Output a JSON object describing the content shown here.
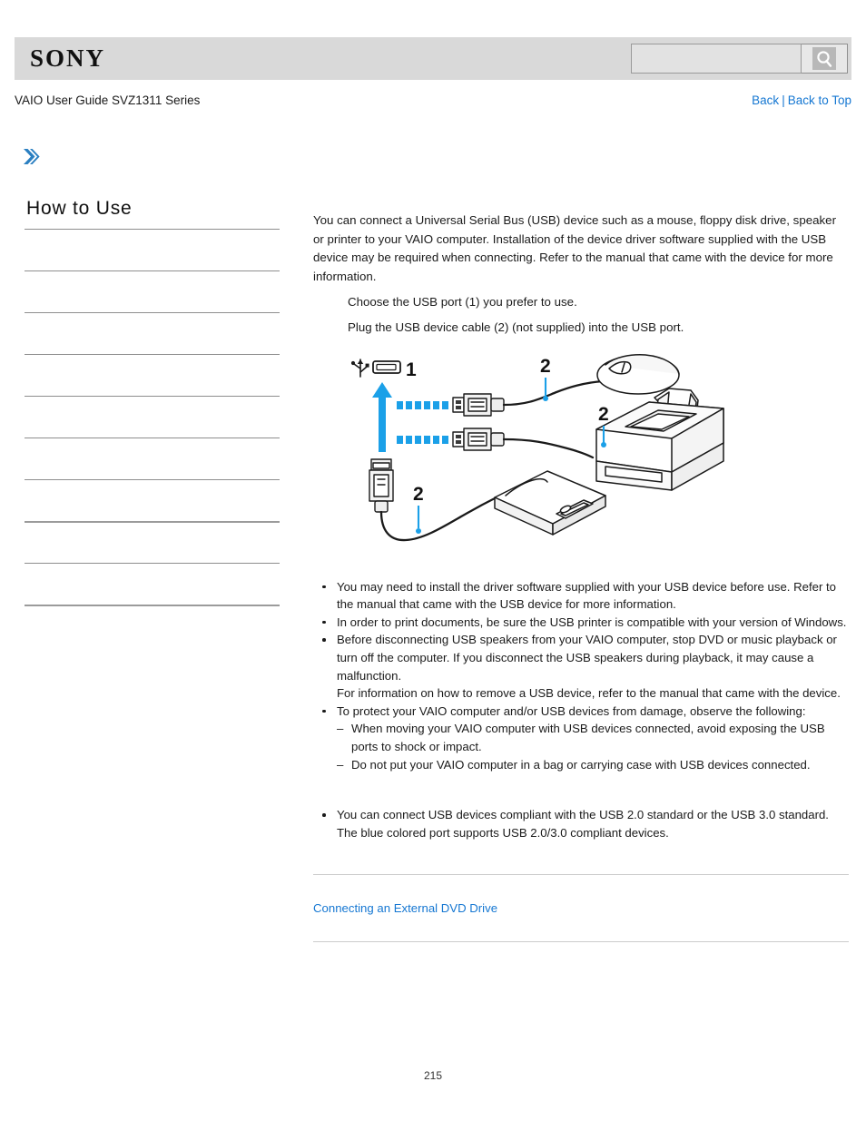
{
  "header": {
    "logo_text": "SONY",
    "search": {
      "value": "",
      "placeholder": "",
      "icon": "search-icon"
    }
  },
  "subheader": {
    "guide_title": "VAIO User Guide SVZ1311 Series",
    "links": {
      "back": "Back",
      "separator": "|",
      "back_to_top": "Back to Top"
    }
  },
  "breadcrumb_icon": "double-chevron-right-icon",
  "sidebar": {
    "title": "How to Use",
    "items": [
      {
        "label": ""
      },
      {
        "label": ""
      },
      {
        "label": ""
      },
      {
        "label": ""
      },
      {
        "label": ""
      },
      {
        "label": ""
      },
      {
        "label": ""
      },
      {
        "label": ""
      },
      {
        "label": ""
      },
      {
        "label": ""
      }
    ]
  },
  "main": {
    "intro": "You can connect a Universal Serial Bus (USB) device such as a mouse, floppy disk drive, speaker or printer to your VAIO computer. Installation of the device driver software supplied with the USB device may be required when connecting. Refer to the manual that came with the device for more information.",
    "steps": [
      "Choose the USB port (1) you prefer to use.",
      "Plug the USB device cable (2) (not supplied) into the USB port."
    ],
    "illustration": {
      "name": "usb-connection-diagram",
      "callout_port": "1",
      "callout_cable_mouse": "2",
      "callout_cable_printer": "2",
      "callout_cable_drive": "2",
      "devices": [
        "mouse",
        "printer",
        "floppy-disk-drive"
      ],
      "accent_color": "#1ba0e8"
    },
    "notes": [
      {
        "text": "You may need to install the driver software supplied with your USB device before use. Refer to the manual that came with the USB device for more information."
      },
      {
        "text": "In order to print documents, be sure the USB printer is compatible with your version of Windows."
      },
      {
        "text": "Before disconnecting USB speakers from your VAIO computer, stop DVD or music playback or turn off the computer. If you disconnect the USB speakers during playback, it may cause a malfunction.",
        "extra": "For information on how to remove a USB device, refer to the manual that came with the device."
      },
      {
        "text": "To protect your VAIO computer and/or USB devices from damage, observe the following:",
        "subnotes": [
          "When moving your VAIO computer with USB devices connected, avoid exposing the USB ports to shock or impact.",
          "Do not put your VAIO computer in a bag or carrying case with USB devices connected."
        ]
      }
    ],
    "notes_second": [
      {
        "text": "You can connect USB devices compliant with the USB 2.0 standard or the USB 3.0 standard.",
        "extra": "The blue colored port supports USB 2.0/3.0 compliant devices."
      }
    ],
    "related_link": "Connecting an External DVD Drive"
  },
  "footer": {
    "page_number": "215"
  },
  "colors": {
    "link": "#1577d2",
    "header_band": "#d9d9d9",
    "accent_blue": "#1ba0e8",
    "divider": "#8e8e8e"
  }
}
